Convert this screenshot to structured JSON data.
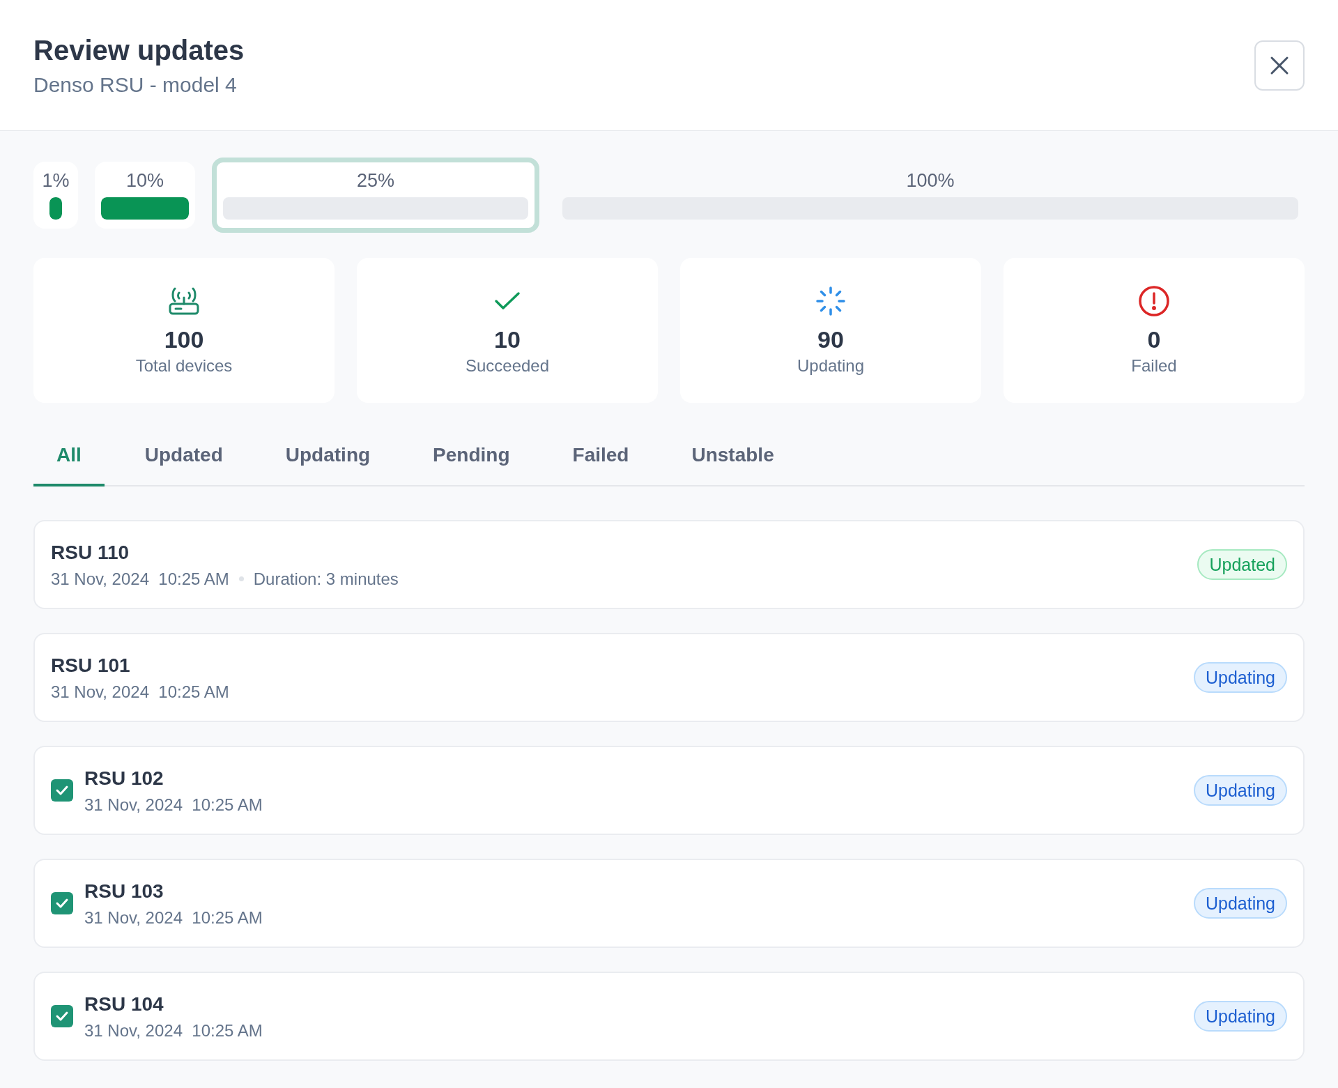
{
  "header": {
    "title": "Review updates",
    "subtitle": "Denso RSU - model 4"
  },
  "stages": [
    {
      "label": "1%",
      "level": 1,
      "selected": false
    },
    {
      "label": "10%",
      "level": 1,
      "selected": false
    },
    {
      "label": "25%",
      "level": 0,
      "selected": true
    },
    {
      "label": "100%",
      "level": 0,
      "selected": false
    }
  ],
  "stats": [
    {
      "kind": "total",
      "value": "100",
      "label": "Total devices"
    },
    {
      "kind": "succeeded",
      "value": "10",
      "label": "Succeeded"
    },
    {
      "kind": "updating",
      "value": "90",
      "label": "Updating"
    },
    {
      "kind": "failed",
      "value": "0",
      "label": "Failed"
    }
  ],
  "tabs": [
    {
      "label": "All",
      "selected": true
    },
    {
      "label": "Updated",
      "selected": false
    },
    {
      "label": "Updating",
      "selected": false
    },
    {
      "label": "Pending",
      "selected": false
    },
    {
      "label": "Failed",
      "selected": false
    },
    {
      "label": "Unstable",
      "selected": false
    }
  ],
  "devices": [
    {
      "name": "RSU 110",
      "date": "31 Nov, 2024  10:25 AM",
      "duration": "Duration: 3 minutes",
      "status": {
        "kind": "updated",
        "label": "Updated"
      }
    },
    {
      "name": "RSU 101",
      "date": "31 Nov, 2024  10:25 AM",
      "status": {
        "kind": "updating",
        "label": "Updating"
      }
    },
    {
      "name": "RSU 102",
      "date": "31 Nov, 2024  10:25 AM",
      "checked": true,
      "status": {
        "kind": "updating",
        "label": "Updating"
      }
    },
    {
      "name": "RSU 103",
      "date": "31 Nov, 2024  10:25 AM",
      "checked": true,
      "status": {
        "kind": "updating",
        "label": "Updating"
      }
    },
    {
      "name": "RSU 104",
      "date": "31 Nov, 2024  10:25 AM",
      "checked": true,
      "status": {
        "kind": "updating",
        "label": "Updating"
      }
    }
  ]
}
